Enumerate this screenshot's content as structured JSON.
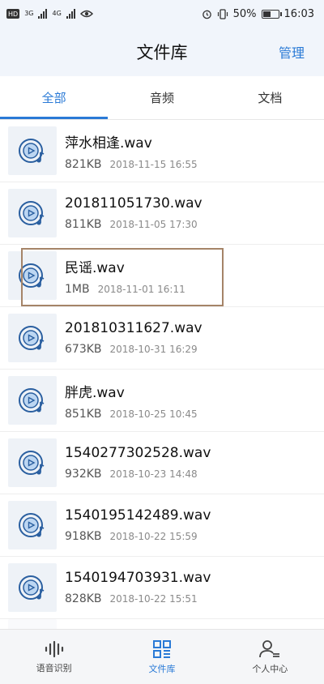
{
  "status_bar": {
    "left_chip": "HD",
    "net1": "3G",
    "net2": "4G",
    "battery": "50%",
    "time": "16:03"
  },
  "header": {
    "title": "文件库",
    "action": "管理"
  },
  "tabs": [
    {
      "label": "全部",
      "active": true
    },
    {
      "label": "音频",
      "active": false
    },
    {
      "label": "文档",
      "active": false
    }
  ],
  "files": [
    {
      "name": "萍水相逢.wav",
      "size": "821KB",
      "date": "2018-11-15 16:55"
    },
    {
      "name": "201811051730.wav",
      "size": "811KB",
      "date": "2018-11-05 17:30"
    },
    {
      "name": "民谣.wav",
      "size": "1MB",
      "date": "2018-11-01 16:11"
    },
    {
      "name": "201810311627.wav",
      "size": "673KB",
      "date": "2018-10-31 16:29"
    },
    {
      "name": "胖虎.wav",
      "size": "851KB",
      "date": "2018-10-25 10:45"
    },
    {
      "name": "1540277302528.wav",
      "size": "932KB",
      "date": "2018-10-23 14:48"
    },
    {
      "name": "1540195142489.wav",
      "size": "918KB",
      "date": "2018-10-22 15:59"
    },
    {
      "name": "1540194703931.wav",
      "size": "828KB",
      "date": "2018-10-22 15:51"
    }
  ],
  "bottom_nav": [
    {
      "label": "语音识别",
      "icon": "waveform-icon",
      "active": false
    },
    {
      "label": "文件库",
      "icon": "grid-icon",
      "active": true
    },
    {
      "label": "个人中心",
      "icon": "person-icon",
      "active": false
    }
  ],
  "colors": {
    "accent": "#2a7ad6",
    "highlight_border": "#a58468"
  }
}
